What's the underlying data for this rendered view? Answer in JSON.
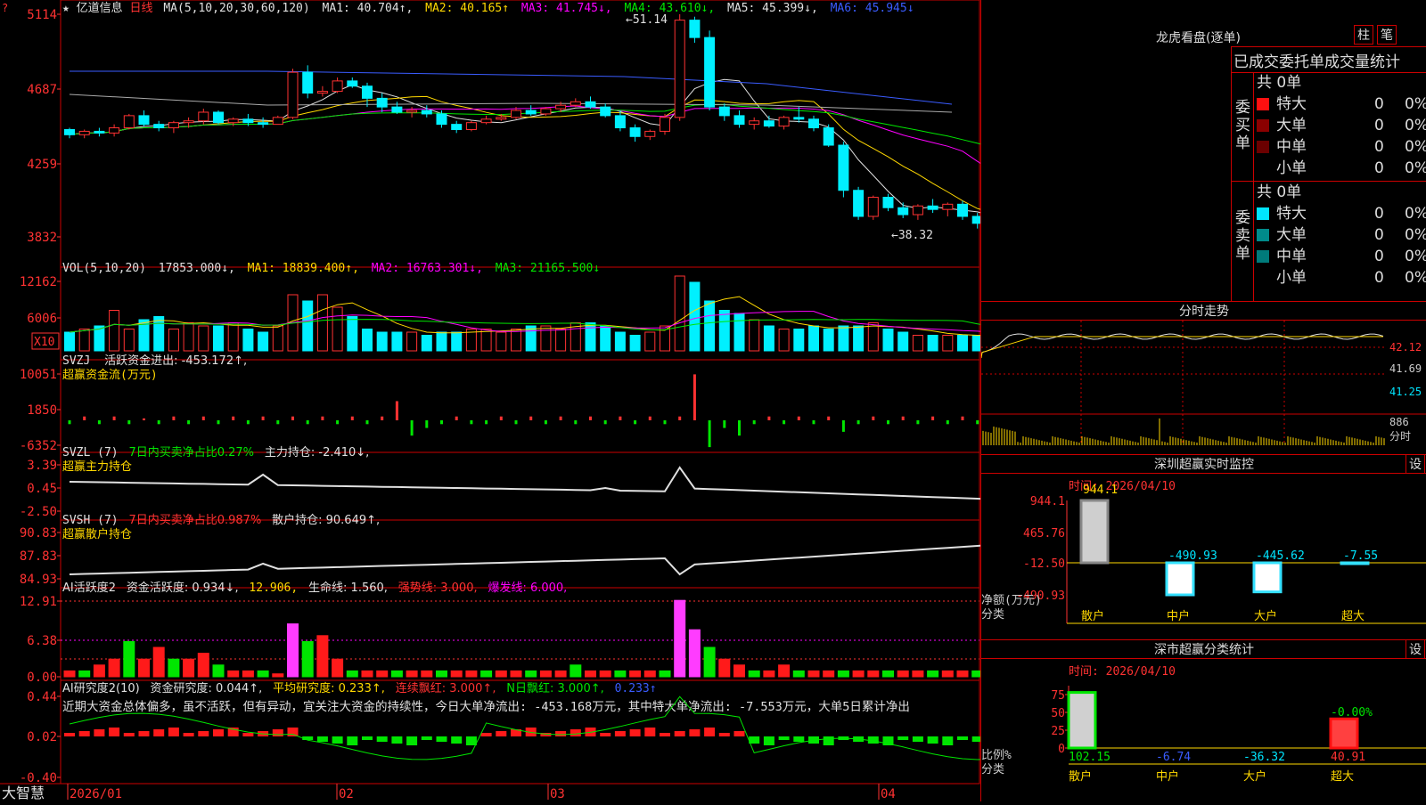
{
  "header": {
    "star": "★",
    "stock_name": "亿道信息",
    "period": "日线",
    "ma_spec": "MA(5,10,20,30,60,120)",
    "ma1": "MA1: 40.704↑,",
    "ma2": "MA2: 40.165↑",
    "ma3": "MA3: 41.745↓,",
    "ma4": "MA4: 43.610↓,",
    "ma5": "MA5: 45.399↓,",
    "ma6": "MA6: 45.945↓",
    "high_label": "51.14",
    "low_label": "←38.32",
    "high_arrow": "←"
  },
  "price_axis": {
    "ticks": [
      "5114",
      "4687",
      "4259",
      "3832"
    ]
  },
  "vol": {
    "title": "VOL(5,10,20)",
    "value": "17853.000↓,",
    "ma1": "MA1: 18839.400↑,",
    "ma2": "MA2: 16763.301↓,",
    "ma3": "MA3: 21165.500↓",
    "ticks": [
      "12162",
      "6006"
    ],
    "unit": "X10"
  },
  "svzj": {
    "title": "SVZJ",
    "text": "活跃资金进出: -453.172↑,",
    "subtitle": "超赢资金流(万元)",
    "ticks": [
      "10051",
      "1850",
      "-6352"
    ]
  },
  "svzl": {
    "title": "SVZL (7)",
    "pct": "7日内买卖净占比0.27%",
    "text": "主力持仓: -2.410↓,",
    "subtitle": "超赢主力持仓",
    "ticks": [
      "3.39",
      "0.45",
      "-2.50"
    ]
  },
  "svsh": {
    "title": "SVSH (7)",
    "pct": "7日内买卖净占比0.987%",
    "text": "散户持仓: 90.649↑,",
    "subtitle": "超赢散户持仓",
    "ticks": [
      "90.83",
      "87.83",
      "84.93"
    ]
  },
  "ai_active": {
    "title": "AI活跃度2",
    "t1": "资金活跃度: 0.934↓,",
    "t2": "12.906,",
    "t3": "生命线: 1.560,",
    "t4": "强势线: 3.000,",
    "t5": "爆发线: 6.000,",
    "ticks": [
      "12.91",
      "6.38",
      "0.00"
    ]
  },
  "ai_research": {
    "title": "AI研究度2(10)",
    "t1": "资金研究度: 0.044↑,",
    "t2": "平均研究度: 0.233↑,",
    "t3": "连续飘红: 3.000↑,",
    "t4": "N日飘红: 3.000↑,",
    "t5": "0.233↑",
    "comment": "近期大资金总体偏多，虽不活跃，但有异动，宜关注大资金的持续性，今日大单净流出: -453.168万元，其中特大单净流出: -7.553万元，大单5日累计净出",
    "ticks": [
      "0.44",
      "0.02",
      "-0.40"
    ]
  },
  "bottom": {
    "brand": "大智慧",
    "dates": [
      "2026/01",
      "02",
      "03",
      "04"
    ]
  },
  "right": {
    "title": "龙虎看盘(逐单)",
    "btn_bar": "柱",
    "btn_pen": "笔",
    "stats_title": "已成交委托单成交量统计",
    "buy_label": "委买单",
    "sell_label": "委卖单",
    "buy_total": "共 0单",
    "sell_total": "共 0单",
    "buy_rows": [
      {
        "name": "特大",
        "count": "0",
        "pct": "0%",
        "color": "#ff1010"
      },
      {
        "name": "大单",
        "count": "0",
        "pct": "0%",
        "color": "#8b0000"
      },
      {
        "name": "中单",
        "count": "0",
        "pct": "0%",
        "color": "#6b0000"
      },
      {
        "name": "小单",
        "count": "0",
        "pct": "0%",
        "color": ""
      }
    ],
    "sell_rows": [
      {
        "name": "特大",
        "count": "0",
        "pct": "0%",
        "color": "#00e5ff"
      },
      {
        "name": "大单",
        "count": "0",
        "pct": "0%",
        "color": "#008b8b"
      },
      {
        "name": "中单",
        "count": "0",
        "pct": "0%",
        "color": "#007b7b"
      },
      {
        "name": "小单",
        "count": "0",
        "pct": "0%",
        "color": ""
      }
    ],
    "intraday_title": "分时走势",
    "intraday_ticks": [
      "42.12",
      "41.69",
      "41.25",
      "886",
      "分时"
    ],
    "monitor_title": "深圳超赢实时监控",
    "monitor_btn": "设",
    "monitor_time": "时间: 2026/04/10",
    "monitor_ticks": [
      "944.1",
      "465.76",
      "-12.50",
      "-490.93"
    ],
    "monitor_axis_label1": "净额(万元)",
    "monitor_axis_label2": "分类",
    "monitor_top_value": "944.1",
    "classify_title": "深市超赢分类统计",
    "classify_btn": "设",
    "classify_time": "时间: 2026/04/10",
    "classify_ticks": [
      "75",
      "50",
      "25",
      "0"
    ],
    "classify_axis_label1": "比例%",
    "classify_axis_label2": "分类",
    "classify_extra": "-0.00%"
  },
  "chart_data": [
    {
      "type": "bar",
      "title": "深圳超赢实时监控",
      "categories": [
        "散户",
        "中户",
        "大户",
        "超大"
      ],
      "values": [
        944.1,
        -490.93,
        -445.62,
        -7.55
      ],
      "ylim": [
        -490.93,
        944.1
      ]
    },
    {
      "type": "bar",
      "title": "深市超赢分类统计",
      "categories": [
        "散户",
        "中户",
        "大户",
        "超大"
      ],
      "values": [
        102.15,
        -6.74,
        -36.32,
        40.91
      ],
      "ylim": [
        0,
        75
      ]
    },
    {
      "type": "candlestick",
      "title": "亿道信息 日线",
      "x": [
        "2026/01",
        "02",
        "03",
        "04"
      ],
      "ylim": [
        38.32,
        51.14
      ],
      "ohlc": [
        [
          44.5,
          44.6,
          44.0,
          44.2
        ],
        [
          44.2,
          44.5,
          44.0,
          44.4
        ],
        [
          44.4,
          44.6,
          44.1,
          44.3
        ],
        [
          44.3,
          44.8,
          44.1,
          44.6
        ],
        [
          44.6,
          45.4,
          44.5,
          45.3
        ],
        [
          45.3,
          45.6,
          44.7,
          44.8
        ],
        [
          44.8,
          45.0,
          44.4,
          44.6
        ],
        [
          44.6,
          45.0,
          44.3,
          44.9
        ],
        [
          44.9,
          45.2,
          44.6,
          45.0
        ],
        [
          45.0,
          45.7,
          44.8,
          45.5
        ],
        [
          45.5,
          45.6,
          44.8,
          44.9
        ],
        [
          44.9,
          45.2,
          44.7,
          45.1
        ],
        [
          45.1,
          45.4,
          44.7,
          44.9
        ],
        [
          44.9,
          45.2,
          44.6,
          44.8
        ],
        [
          44.8,
          45.3,
          44.8,
          45.2
        ],
        [
          45.2,
          48.0,
          45.1,
          47.8
        ],
        [
          47.8,
          48.2,
          46.3,
          46.6
        ],
        [
          46.6,
          47.0,
          46.4,
          46.7
        ],
        [
          46.7,
          47.5,
          46.6,
          47.3
        ],
        [
          47.3,
          47.5,
          46.9,
          47.0
        ],
        [
          47.0,
          47.2,
          45.8,
          46.3
        ],
        [
          46.3,
          46.6,
          45.5,
          45.8
        ],
        [
          45.8,
          46.1,
          45.4,
          45.5
        ],
        [
          45.5,
          45.8,
          45.2,
          45.6
        ],
        [
          45.6,
          45.9,
          45.2,
          45.4
        ],
        [
          45.4,
          45.6,
          44.6,
          44.8
        ],
        [
          44.8,
          45.0,
          44.3,
          44.5
        ],
        [
          44.5,
          45.0,
          44.4,
          44.9
        ],
        [
          44.9,
          45.3,
          44.8,
          45.1
        ],
        [
          45.1,
          45.4,
          45.0,
          45.2
        ],
        [
          45.2,
          45.8,
          45.1,
          45.6
        ],
        [
          45.6,
          45.9,
          45.3,
          45.4
        ],
        [
          45.4,
          45.8,
          45.3,
          45.7
        ],
        [
          45.7,
          46.1,
          45.5,
          45.9
        ],
        [
          45.9,
          46.3,
          45.8,
          46.1
        ],
        [
          46.1,
          46.4,
          45.7,
          45.8
        ],
        [
          45.8,
          46.0,
          45.2,
          45.3
        ],
        [
          45.3,
          45.6,
          44.4,
          44.6
        ],
        [
          44.6,
          44.8,
          43.8,
          44.1
        ],
        [
          44.1,
          44.5,
          43.9,
          44.4
        ],
        [
          44.4,
          45.4,
          44.2,
          45.2
        ],
        [
          45.2,
          51.14,
          45.0,
          50.8
        ],
        [
          50.8,
          51.0,
          49.5,
          49.8
        ],
        [
          49.8,
          50.2,
          45.6,
          45.8
        ],
        [
          45.8,
          46.0,
          45.0,
          45.3
        ],
        [
          45.3,
          45.6,
          44.6,
          44.8
        ],
        [
          44.8,
          45.2,
          44.5,
          45.0
        ],
        [
          45.0,
          45.3,
          44.6,
          44.7
        ],
        [
          44.7,
          45.3,
          44.5,
          45.2
        ],
        [
          45.2,
          45.8,
          44.9,
          45.1
        ],
        [
          45.1,
          45.3,
          44.4,
          44.6
        ],
        [
          44.6,
          44.8,
          43.5,
          43.6
        ],
        [
          43.6,
          43.8,
          40.6,
          41.0
        ],
        [
          41.0,
          41.2,
          39.3,
          39.5
        ],
        [
          39.5,
          40.7,
          39.3,
          40.6
        ],
        [
          40.6,
          40.8,
          39.8,
          40.0
        ],
        [
          40.0,
          40.3,
          39.4,
          39.6
        ],
        [
          39.6,
          40.2,
          39.3,
          40.1
        ],
        [
          40.1,
          40.5,
          39.7,
          39.9
        ],
        [
          39.9,
          40.3,
          39.5,
          40.2
        ],
        [
          40.2,
          40.4,
          39.3,
          39.5
        ],
        [
          39.5,
          39.7,
          38.8,
          39.1
        ],
        [
          39.1,
          39.3,
          38.32,
          38.8
        ],
        [
          38.8,
          40.5,
          38.7,
          40.3
        ],
        [
          40.3,
          41.0,
          40.1,
          40.8
        ],
        [
          40.8,
          41.3,
          40.5,
          41.1
        ]
      ]
    }
  ]
}
